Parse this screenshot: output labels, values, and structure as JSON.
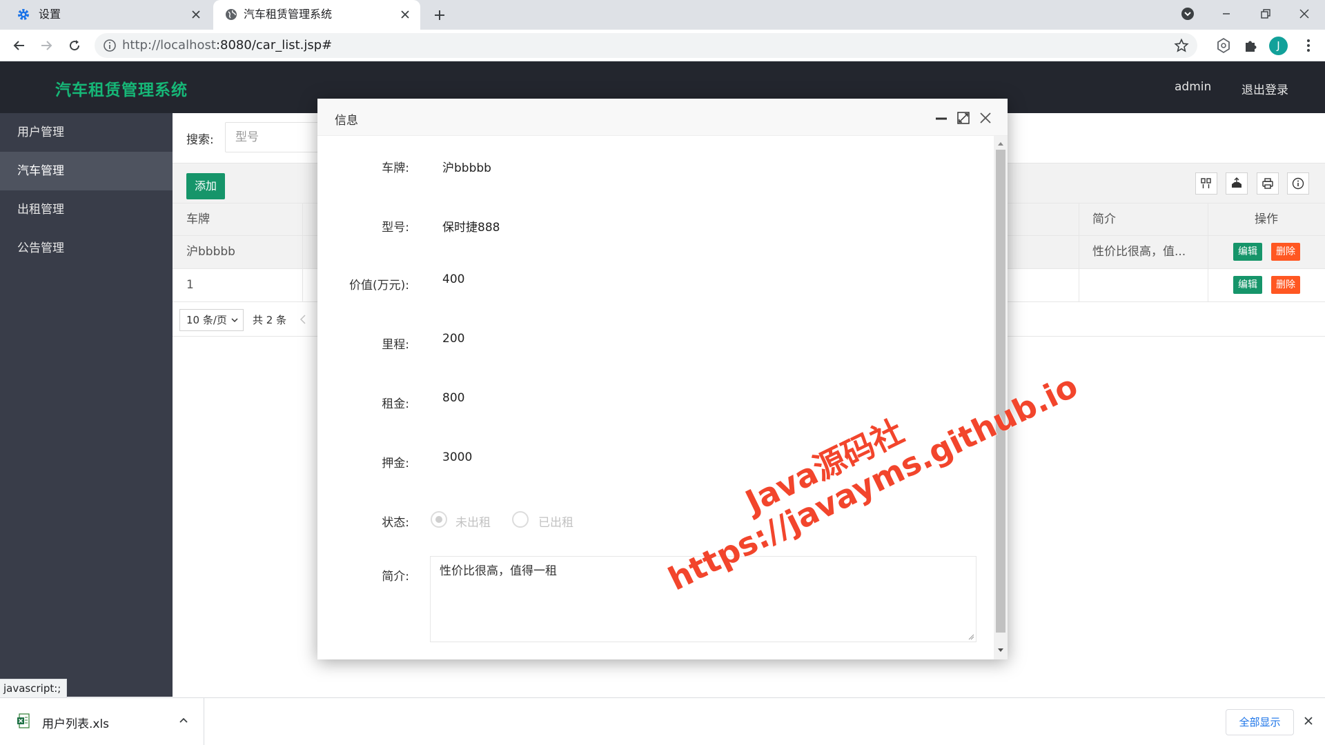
{
  "browser": {
    "tabs": [
      {
        "title": "设置"
      },
      {
        "title": "汽车租赁管理系统"
      }
    ],
    "url": {
      "host": "http://localhost",
      "rest": ":8080/car_list.jsp#"
    },
    "avatar_letter": "J"
  },
  "app": {
    "logo": "汽车租赁管理系统",
    "header_user": "admin",
    "header_logout": "退出登录",
    "sidebar": [
      {
        "label": "用户管理"
      },
      {
        "label": "汽车管理"
      },
      {
        "label": "出租管理"
      },
      {
        "label": "公告管理"
      }
    ],
    "search": {
      "label": "搜索:",
      "placeholder": "型号"
    },
    "add_button": "添加",
    "table": {
      "columns": {
        "plate": "车牌",
        "intro": "简介",
        "actions": "操作"
      },
      "rows": [
        {
          "plate": "沪bbbbb",
          "intro": "性价比很高，值..."
        },
        {
          "plate": "1",
          "intro": ""
        }
      ],
      "edit_label": "编辑",
      "delete_label": "删除"
    },
    "pager": {
      "page_size": "10 条/页",
      "total": "共 2 条"
    }
  },
  "modal": {
    "title": "信息",
    "fields": {
      "plate": {
        "label": "车牌:",
        "value": "沪bbbbb"
      },
      "model": {
        "label": "型号:",
        "value": "保时捷888"
      },
      "price": {
        "label": "价值(万元):",
        "value": "400"
      },
      "mileage": {
        "label": "里程:",
        "value": "200"
      },
      "rent": {
        "label": "租金:",
        "value": "800"
      },
      "deposit": {
        "label": "押金:",
        "value": "3000"
      },
      "status": {
        "label": "状态:",
        "options": [
          "未出租",
          "已出租"
        ],
        "selected": "未出租"
      },
      "intro": {
        "label": "简介:",
        "value": "性价比很高，值得一租"
      }
    }
  },
  "status_tip": "javascript:;",
  "download": {
    "file": "用户列表.xls",
    "show_all": "全部显示"
  },
  "watermark": {
    "line1": "Java源码社",
    "line2": "https://javayms.github.io"
  },
  "colors": {
    "accent_green": "#16956a",
    "logo_green": "#16b777",
    "danger": "#ff5722",
    "watermark": "#f2452c"
  }
}
